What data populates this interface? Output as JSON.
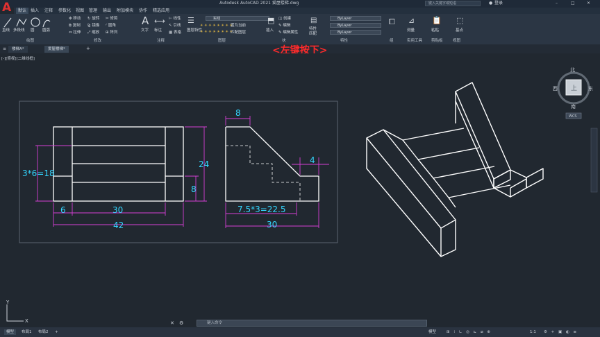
{
  "window": {
    "title": "Autodesk AutoCAD 2021    爱屋楼梯.dwg",
    "search_placeholder": "键入关键字或短语",
    "user": "登录"
  },
  "menu": [
    "默认",
    "插入",
    "注释",
    "参数化",
    "视图",
    "管理",
    "输出",
    "附加模块",
    "协作",
    "精选应用"
  ],
  "ribbon": {
    "draw_tools": [
      "直线",
      "多段线",
      "圆",
      "圆弧"
    ],
    "modify_tools": [
      "移动",
      "旋转",
      "修剪",
      "复制",
      "镜像",
      "圆角",
      "拉伸",
      "缩放",
      "阵列"
    ],
    "annotation_tools": [
      "文字",
      "标注",
      "线性",
      "引线",
      "表格"
    ],
    "layer_tools": [
      "图层特性",
      "置为当前",
      "匹配图层"
    ],
    "block_tools": [
      "插入",
      "创建",
      "编辑",
      "编辑属性"
    ],
    "property_tools": [
      "特性",
      "匹配"
    ],
    "property_values": [
      "ByLayer",
      "ByLayer",
      "ByLayer"
    ],
    "linetype": "实线",
    "utility_tools": [
      "测量"
    ],
    "clipboard_tools": [
      "粘贴"
    ],
    "view_tools": [
      "基点"
    ],
    "panels": [
      "绘图",
      "修改",
      "注释",
      "图层",
      "块",
      "特性",
      "组",
      "实用工具",
      "剪贴板",
      "视图"
    ]
  },
  "tabs": [
    "楼梯A*",
    "爱屋楼梯*"
  ],
  "viewport_label": "[-][俯视][二维线框]",
  "overlay_text": "<左键按下>",
  "viewcube": {
    "north": "北",
    "south": "南",
    "east": "东",
    "west": "西",
    "top": "上",
    "wcs": "WCS"
  },
  "dimensions": {
    "front_height_stack": "3*6=18",
    "front_width_left": "6",
    "front_width_mid": "30",
    "front_total_width": "42",
    "front_height_total": "24",
    "front_height_base": "8",
    "side_top_width": "8",
    "side_step": "4",
    "side_stack": "7.5*3=22.5",
    "side_total": "30"
  },
  "ucs": {
    "x": "X",
    "y": "Y"
  },
  "command_placeholder": "键入命令",
  "status": {
    "model_tabs": [
      "模型",
      "布局1",
      "布局2"
    ],
    "mode": "模型",
    "scale": "1:1"
  }
}
